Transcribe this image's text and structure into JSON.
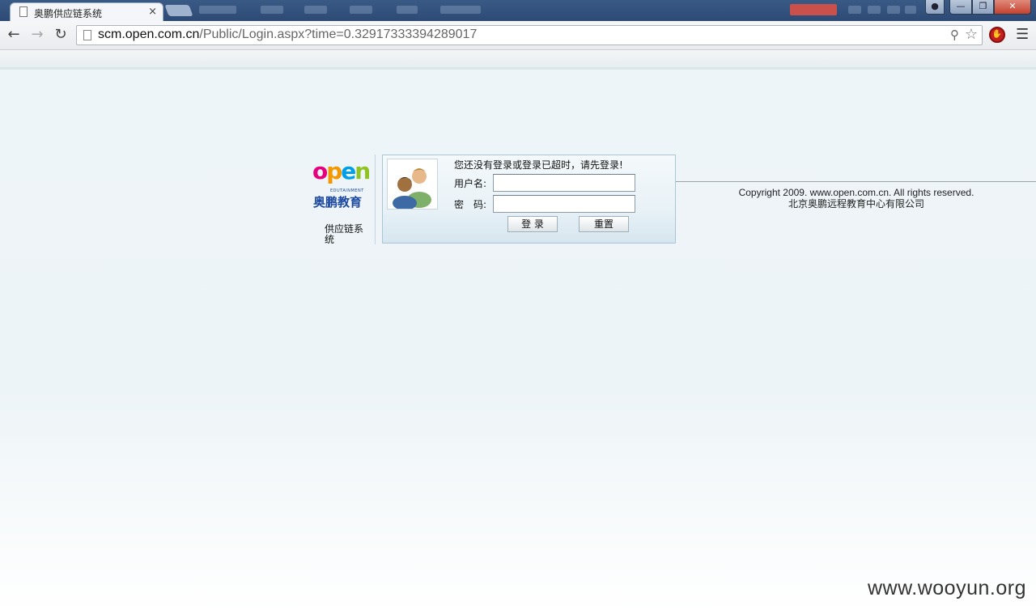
{
  "browser": {
    "tab_title": "奥鹏供应链系统",
    "tab_close": "×",
    "url_host": "scm.open.com.cn",
    "url_path": "/Public/Login.aspx?time=0.32917333394289017",
    "icons": {
      "back": "back-arrow-icon",
      "forward": "forward-arrow-icon",
      "reload": "reload-icon",
      "zoom": "zoom-icon",
      "star": "bookmark-star-icon",
      "extension": "adblock-icon",
      "menu": "menu-icon"
    },
    "glyphs": {
      "back": "←",
      "forward": "→",
      "reload": "↻",
      "zoom": "⚲",
      "star": "☆",
      "menu": "☰",
      "minimize": "—",
      "maximize": "❐",
      "close": "✕"
    }
  },
  "logo": {
    "brand": "open",
    "brand_letters": [
      "o",
      "p",
      "e",
      "n"
    ],
    "brand_cn": "奥鹏教育",
    "tagline": "EDUTAINMENT"
  },
  "system_name": "供应链系统",
  "login": {
    "message": "您还没有登录或登录已超时，请先登录!",
    "username_label": "用户名:",
    "password_label": "密　码:",
    "username_value": "",
    "password_value": "",
    "login_button": "登 录",
    "reset_button": "重置"
  },
  "footer": {
    "copyright": "Copyright 2009. www.open.com.cn. All rights reserved.",
    "company": "北京奥鹏远程教育中心有限公司"
  },
  "watermark": "www.wooyun.org",
  "colors": {
    "brand_o": "#e6007e",
    "brand_p": "#f39800",
    "brand_e": "#009fe8",
    "brand_n": "#8fc31f",
    "brand_blue": "#1e4aa0",
    "window_close": "#c5412d"
  }
}
